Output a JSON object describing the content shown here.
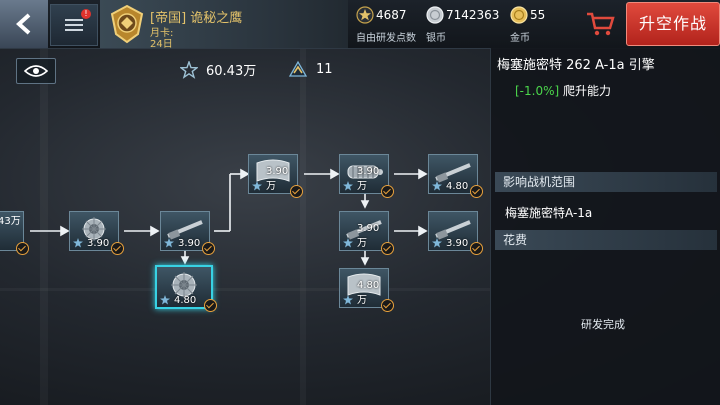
{
  "topbar": {
    "player_name": "[帝国] 诡秘之鹰",
    "month_card_label": "月卡:",
    "month_card_days": "24日",
    "notification_badge": "!",
    "currencies": [
      {
        "icon": "star-icon",
        "value": "4687",
        "label": "自由研发点数"
      },
      {
        "icon": "silver-coin-icon",
        "value": "7142363",
        "label": "银币"
      },
      {
        "icon": "gold-coin-icon",
        "value": "55",
        "label": "金币"
      }
    ],
    "launch_label": "升空作战"
  },
  "stats": {
    "research_points": "60.43万",
    "rank_count": "11"
  },
  "tree": {
    "edge_node_value": "43万",
    "nodes": [
      {
        "id": "n1",
        "part": "gear",
        "value": "3.90"
      },
      {
        "id": "n2",
        "part": "barrel",
        "value": "3.90"
      },
      {
        "id": "n3",
        "part": "gear",
        "value": "4.80"
      },
      {
        "id": "n4",
        "part": "plate",
        "value": "3.90万"
      },
      {
        "id": "n5",
        "part": "engine",
        "value": "3.90万"
      },
      {
        "id": "n6",
        "part": "barrel",
        "value": "4.80"
      },
      {
        "id": "n7",
        "part": "barrel",
        "value": "3.90万"
      },
      {
        "id": "n8",
        "part": "barrel",
        "value": "3.90"
      },
      {
        "id": "n9",
        "part": "plate",
        "value": "4.80万"
      }
    ]
  },
  "panel": {
    "title": "梅塞施密特 262 A-1a 引擎",
    "effect_pct": "[-1.0%]",
    "effect_text": "爬升能力",
    "affects_header": "影响战机范围",
    "affects_value": "梅塞施密特A-1a",
    "cost_header": "花费",
    "status_text": "研发完成"
  },
  "colors": {
    "accent": "#38d2e4",
    "launch": "#c93326",
    "gold_text": "#e3c26a",
    "positive": "#4bd64b",
    "check": "#e8a13c"
  }
}
